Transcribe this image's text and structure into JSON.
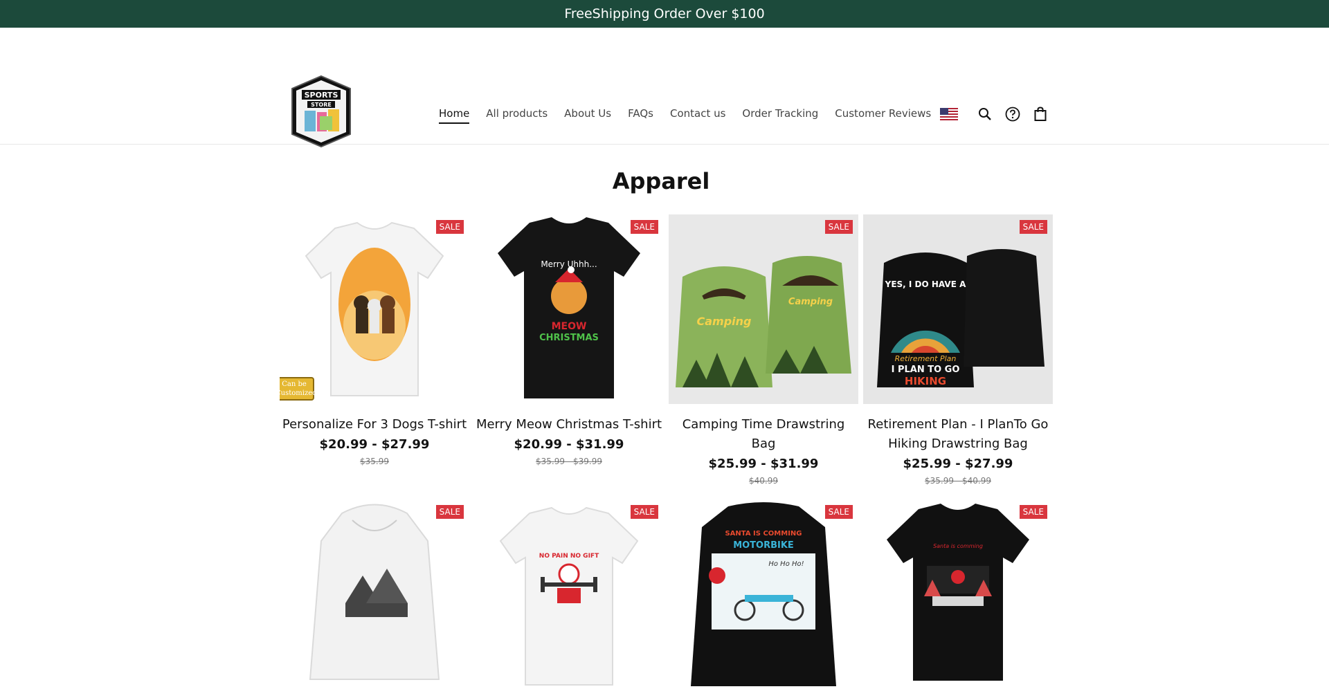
{
  "announcement": {
    "text": "FreeShipping Order Over $100"
  },
  "header": {
    "logo_text": [
      "SPORTS",
      "STORE"
    ],
    "nav": [
      {
        "label": "Home",
        "active": true
      },
      {
        "label": " All products"
      },
      {
        "label": "About Us"
      },
      {
        "label": "FAQs"
      },
      {
        "label": "Contact us"
      },
      {
        "label": "Order Tracking"
      },
      {
        "label": "Customer Reviews"
      }
    ],
    "icons": [
      "us-flag-icon",
      "search-icon",
      "help-icon",
      "shopping-bag-icon"
    ]
  },
  "collection": {
    "title": "Apparel",
    "products": [
      {
        "title": "Personalize For 3 Dogs T-shirt",
        "price": "$20.99 - $27.99",
        "compare": "$35.99",
        "badge": "SALE",
        "customized": "Can be Customized"
      },
      {
        "title": "Merry Meow Christmas T-shirt",
        "price": "$20.99 - $31.99",
        "compare": "$35.99 - $39.99",
        "badge": "SALE"
      },
      {
        "title": "Camping Time Drawstring Bag",
        "price": "$25.99 - $31.99",
        "compare": "$40.99",
        "badge": "SALE"
      },
      {
        "title": "Retirement Plan - I PlanTo Go Hiking Drawstring Bag",
        "price": "$25.99 - $27.99",
        "compare": "$35.99 - $40.99",
        "badge": "SALE"
      },
      {
        "title": "",
        "price": "",
        "compare": "",
        "badge": "SALE"
      },
      {
        "title": "",
        "price": "",
        "compare": "",
        "badge": "SALE"
      },
      {
        "title": "",
        "price": "",
        "compare": "",
        "badge": "SALE"
      },
      {
        "title": "",
        "price": "",
        "compare": "",
        "badge": "SALE"
      }
    ],
    "image_text": {
      "p0": "",
      "p1": [
        "Merry Uhhh...",
        "MEOW",
        "CHRISTMAS"
      ],
      "p2": [
        "Camping",
        "Camping"
      ],
      "p3": [
        "YES, I DO HAVE A",
        "Retirement Plan",
        "I PLAN TO GO",
        "HIKING"
      ],
      "p5": [
        "NO PAIN NO GIFT"
      ],
      "p6": [
        "SANTA IS COMMING",
        "MOTORBIKE",
        "Ho Ho Ho!"
      ],
      "p7": [
        "Santa is comming"
      ]
    }
  }
}
